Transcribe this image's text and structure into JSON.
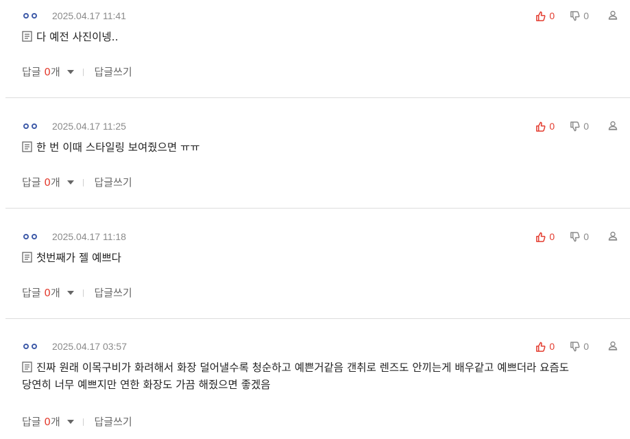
{
  "comments": [
    {
      "user": "oo",
      "date": "2025.04.17 11:41",
      "likes": "0",
      "dislikes": "0",
      "lines": [
        "다 예전 사진이넹.."
      ],
      "reply_label": "답글",
      "reply_count": "0",
      "reply_unit": "개",
      "write_label": "답글쓰기"
    },
    {
      "user": "oo",
      "date": "2025.04.17 11:25",
      "likes": "0",
      "dislikes": "0",
      "lines": [
        "한 번 이때 스타일링 보여줬으면 ㅠㅠ"
      ],
      "reply_label": "답글",
      "reply_count": "0",
      "reply_unit": "개",
      "write_label": "답글쓰기"
    },
    {
      "user": "oo",
      "date": "2025.04.17 11:18",
      "likes": "0",
      "dislikes": "0",
      "lines": [
        "첫번째가 젤 예쁘다"
      ],
      "reply_label": "답글",
      "reply_count": "0",
      "reply_unit": "개",
      "write_label": "답글쓰기"
    },
    {
      "user": "oo",
      "date": "2025.04.17 03:57",
      "likes": "0",
      "dislikes": "0",
      "lines": [
        "진짜 원래 이목구비가 화려해서 화장 덜어낼수록 청순하고 예쁜거같음 갠취로 렌즈도 안끼는게 배우같고 예쁘더라 요즘도",
        "당연히 너무 예쁘지만 연한 화장도 가끔 해줬으면 좋겠음"
      ],
      "reply_label": "답글",
      "reply_count": "0",
      "reply_unit": "개",
      "write_label": "답글쓰기"
    }
  ],
  "colors": {
    "accent_red": "#e33b2e",
    "user_blue": "#3e5aa8",
    "meta_gray": "#8a8a8a"
  },
  "icons": {
    "like": "thumbs-up-icon",
    "dislike": "thumbs-down-icon",
    "report": "report-user-icon",
    "memo": "memo-icon",
    "toggle": "caret-down-icon"
  }
}
